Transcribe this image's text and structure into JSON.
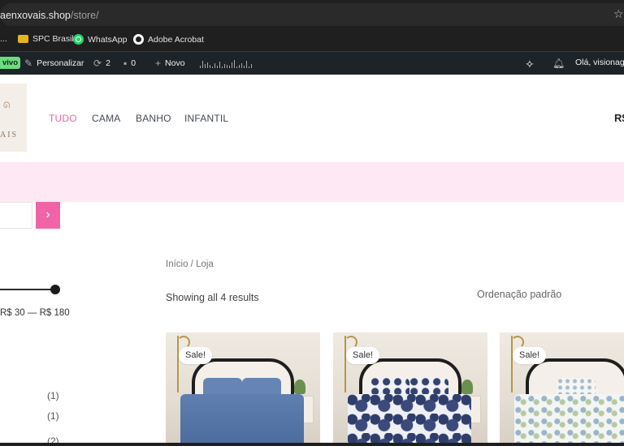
{
  "browser": {
    "url_domain": "aenxovais.shop",
    "url_path": "/store/"
  },
  "bookmarks": [
    {
      "label": "...",
      "icon": "more-icon"
    },
    {
      "label": "SPC Brasil",
      "icon": "folder-icon"
    },
    {
      "label": "WhatsApp",
      "icon": "whatsapp-icon"
    },
    {
      "label": "Adobe Acrobat",
      "icon": "acrobat-icon"
    }
  ],
  "adminbar": {
    "live_badge": "vivo",
    "customize": "Personalizar",
    "updates_count": "2",
    "comments_count": "0",
    "new_label": "Novo",
    "greeting": "Olá, visionage",
    "activity_bars": [
      3,
      9,
      5,
      7,
      4,
      2,
      6,
      3,
      8,
      2,
      5,
      4,
      3,
      7,
      10,
      2,
      4,
      6,
      3,
      9,
      2,
      5
    ]
  },
  "header": {
    "logo_text": "AIS",
    "nav": [
      {
        "label": "TUDO",
        "active": true
      },
      {
        "label": "CAMA",
        "active": false
      },
      {
        "label": "BANHO",
        "active": false
      },
      {
        "label": "INFANTIL",
        "active": false
      }
    ],
    "cart_price": "R$"
  },
  "sidebar": {
    "search_button_icon": "chevron-right-icon",
    "price_filter": {
      "range_text": "R$ 30 — R$ 180",
      "min": 30,
      "max": 180
    },
    "category_counts": [
      "(1)",
      "(1)",
      "(2)"
    ]
  },
  "main": {
    "breadcrumb": "Início / Loja",
    "results_text": "Showing all 4 results",
    "ordering": "Ordenação padrão",
    "products": [
      {
        "badge": "Sale!",
        "variant": "blue"
      },
      {
        "badge": "Sale!",
        "variant": "floral"
      },
      {
        "badge": "Sale!",
        "variant": "light"
      }
    ]
  },
  "colors": {
    "accent_pink": "#f064a6",
    "nav_active": "#e26aa6",
    "band_pink": "#fde8f3",
    "admin_bar": "#1d2327"
  }
}
